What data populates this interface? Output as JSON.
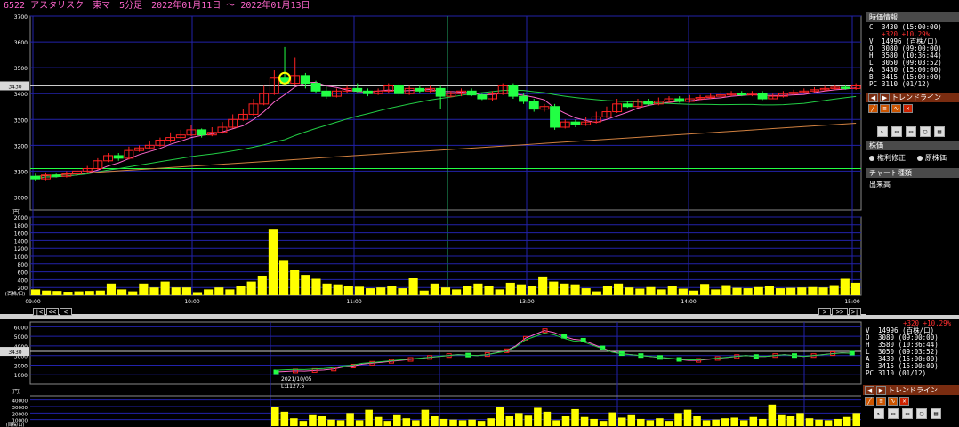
{
  "title": "6522 アスタリスク　東マ　5分足　2022年01月11日 〜 2022年01月13日",
  "colors": {
    "up": "#ff2222",
    "down": "#22ff44",
    "ma_short": "#ff66cc",
    "ma_mid": "#22cc44",
    "ma_long": "#d08040",
    "volume": "#ffff00",
    "grid": "#2222aa",
    "hline": "#22ff44"
  },
  "main_chart": {
    "y_ticks": [
      "3700",
      "3600",
      "3500",
      "3400",
      "3300",
      "3200",
      "3100",
      "3000"
    ],
    "price_marker": "3430",
    "x_ticks": [
      "09:00",
      "10:00",
      "11:00",
      "13:00",
      "14:00",
      "15:00"
    ],
    "candles": [
      [
        3080,
        3070,
        3090,
        3060
      ],
      [
        3070,
        3085,
        3095,
        3065
      ],
      [
        3085,
        3080,
        3090,
        3075
      ],
      [
        3080,
        3090,
        3100,
        3075
      ],
      [
        3090,
        3100,
        3110,
        3085
      ],
      [
        3100,
        3110,
        3120,
        3095
      ],
      [
        3110,
        3140,
        3150,
        3105
      ],
      [
        3140,
        3160,
        3170,
        3135
      ],
      [
        3160,
        3150,
        3170,
        3140
      ],
      [
        3150,
        3180,
        3195,
        3145
      ],
      [
        3180,
        3190,
        3200,
        3175
      ],
      [
        3190,
        3200,
        3215,
        3185
      ],
      [
        3200,
        3220,
        3230,
        3195
      ],
      [
        3220,
        3230,
        3250,
        3210
      ],
      [
        3230,
        3240,
        3260,
        3225
      ],
      [
        3240,
        3260,
        3280,
        3235
      ],
      [
        3260,
        3240,
        3265,
        3230
      ],
      [
        3240,
        3250,
        3270,
        3235
      ],
      [
        3250,
        3270,
        3290,
        3245
      ],
      [
        3270,
        3300,
        3320,
        3265
      ],
      [
        3300,
        3320,
        3340,
        3295
      ],
      [
        3320,
        3360,
        3380,
        3315
      ],
      [
        3360,
        3400,
        3430,
        3355
      ],
      [
        3400,
        3460,
        3490,
        3395
      ],
      [
        3460,
        3440,
        3580,
        3430
      ],
      [
        3440,
        3470,
        3540,
        3435
      ],
      [
        3470,
        3440,
        3480,
        3420
      ],
      [
        3440,
        3410,
        3450,
        3400
      ],
      [
        3410,
        3390,
        3430,
        3380
      ],
      [
        3390,
        3410,
        3420,
        3385
      ],
      [
        3410,
        3420,
        3430,
        3400
      ],
      [
        3420,
        3410,
        3440,
        3405
      ],
      [
        3410,
        3400,
        3420,
        3390
      ],
      [
        3400,
        3410,
        3420,
        3395
      ],
      [
        3410,
        3430,
        3440,
        3400
      ],
      [
        3430,
        3400,
        3440,
        3390
      ],
      [
        3400,
        3420,
        3430,
        3395
      ],
      [
        3420,
        3410,
        3430,
        3400
      ],
      [
        3410,
        3420,
        3430,
        3405
      ],
      [
        3420,
        3390,
        3430,
        3340
      ],
      [
        3390,
        3400,
        3410,
        3385
      ],
      [
        3400,
        3410,
        3420,
        3390
      ],
      [
        3410,
        3395,
        3420,
        3390
      ],
      [
        3395,
        3380,
        3400,
        3375
      ],
      [
        3380,
        3400,
        3410,
        3370
      ],
      [
        3400,
        3430,
        3440,
        3395
      ],
      [
        3430,
        3390,
        3440,
        3380
      ],
      [
        3390,
        3370,
        3400,
        3360
      ],
      [
        3370,
        3340,
        3380,
        3330
      ],
      [
        3340,
        3350,
        3360,
        3330
      ],
      [
        3350,
        3270,
        3360,
        3260
      ],
      [
        3270,
        3290,
        3300,
        3265
      ],
      [
        3290,
        3280,
        3300,
        3270
      ],
      [
        3280,
        3290,
        3310,
        3275
      ],
      [
        3290,
        3310,
        3330,
        3285
      ],
      [
        3310,
        3330,
        3350,
        3305
      ],
      [
        3330,
        3360,
        3380,
        3325
      ],
      [
        3360,
        3350,
        3370,
        3345
      ],
      [
        3350,
        3370,
        3380,
        3345
      ],
      [
        3370,
        3360,
        3380,
        3355
      ],
      [
        3360,
        3370,
        3385,
        3355
      ],
      [
        3370,
        3380,
        3390,
        3365
      ],
      [
        3380,
        3370,
        3390,
        3365
      ],
      [
        3370,
        3380,
        3395,
        3365
      ],
      [
        3380,
        3385,
        3395,
        3375
      ],
      [
        3385,
        3390,
        3400,
        3380
      ],
      [
        3390,
        3395,
        3410,
        3385
      ],
      [
        3395,
        3400,
        3410,
        3390
      ],
      [
        3400,
        3395,
        3410,
        3390
      ],
      [
        3395,
        3400,
        3410,
        3390
      ],
      [
        3400,
        3380,
        3410,
        3375
      ],
      [
        3380,
        3390,
        3400,
        3380
      ],
      [
        3390,
        3400,
        3410,
        3385
      ],
      [
        3400,
        3405,
        3415,
        3395
      ],
      [
        3405,
        3410,
        3420,
        3400
      ],
      [
        3410,
        3415,
        3425,
        3405
      ],
      [
        3415,
        3420,
        3430,
        3410
      ],
      [
        3420,
        3425,
        3435,
        3415
      ],
      [
        3425,
        3420,
        3435,
        3415
      ],
      [
        3420,
        3430,
        3440,
        3415
      ]
    ],
    "volume_ticks": [
      "2000",
      "1800",
      "1600",
      "1400",
      "1200",
      "1000",
      "800",
      "600",
      "400",
      "200"
    ],
    "volume_unit": "(百株/口)",
    "volumes": [
      150,
      120,
      110,
      90,
      100,
      110,
      120,
      300,
      150,
      100,
      300,
      200,
      350,
      200,
      200,
      80,
      150,
      200,
      150,
      250,
      350,
      500,
      1700,
      900,
      650,
      520,
      420,
      300,
      280,
      250,
      220,
      180,
      200,
      250,
      180,
      450,
      120,
      300,
      200,
      150,
      250,
      300,
      250,
      150,
      320,
      280,
      250,
      480,
      350,
      300,
      280,
      180,
      100,
      250,
      300,
      200,
      170,
      210,
      150,
      250,
      170,
      120,
      290,
      150,
      260,
      190,
      180,
      210,
      230,
      180,
      190,
      200,
      210,
      200,
      260,
      420,
      320
    ]
  },
  "unit_label": "(円)",
  "volume_unit_short": "(百株/口)",
  "nav_buttons": [
    "|<",
    "<<",
    "<",
    ">",
    ">>",
    ">|"
  ],
  "info_panel": {
    "header": "時価情報",
    "rows": [
      {
        "key": "C",
        "value": "3430 (15:00:00)"
      },
      {
        "key": "",
        "value": "+320 +10.29%"
      },
      {
        "key": "V",
        "value": "14996 (百株/口)"
      },
      {
        "key": "O",
        "value": "3080 (09:00:00)"
      },
      {
        "key": "H",
        "value": "3580 (10:36:44)"
      },
      {
        "key": "L",
        "value": "3050 (09:03:52)"
      },
      {
        "key": "A",
        "value": "3430 (15:00:00)"
      },
      {
        "key": "B",
        "value": "3415 (15:00:00)"
      },
      {
        "key": "PC",
        "value": "3110 (01/12)"
      }
    ]
  },
  "trendline": {
    "label": "トレンドライン"
  },
  "stock_price": {
    "header": "株価",
    "options": [
      "権利修正",
      "原株価"
    ]
  },
  "chart_type": {
    "header": "チャート種類",
    "value": "出来高"
  },
  "bottom_info": {
    "change": "+320 +10.29%",
    "rows": [
      {
        "key": "V",
        "value": "14996 (百株/口)"
      },
      {
        "key": "O",
        "value": "3080 (09:00:00)"
      },
      {
        "key": "H",
        "value": "3580 (10:36:44)"
      },
      {
        "key": "L",
        "value": "3050 (09:03:52)"
      },
      {
        "key": "A",
        "value": "3430 (15:00:00)"
      },
      {
        "key": "B",
        "value": "3415 (15:00:00)"
      },
      {
        "key": "PC",
        "value": "3110 (01/12)"
      }
    ]
  },
  "bottom_chart": {
    "y_ticks": [
      "6000",
      "5000",
      "4000",
      "3000",
      "2000",
      "1000"
    ],
    "price_marker": "3430",
    "annotation": [
      "2021/10/05",
      "L:1127.5"
    ],
    "vol_ticks": [
      "40000",
      "30000",
      "20000",
      "10000"
    ],
    "line": [
      1300,
      1350,
      1400,
      1380,
      1450,
      1500,
      1600,
      1800,
      1900,
      2100,
      2200,
      2300,
      2400,
      2500,
      2600,
      2700,
      2800,
      2900,
      3000,
      3100,
      3050,
      3000,
      3100,
      3300,
      3500,
      4000,
      4800,
      5200,
      5600,
      5400,
      5000,
      4700,
      4600,
      4200,
      3800,
      3400,
      3200,
      3100,
      3000,
      2900,
      2800,
      2700,
      2600,
      2500,
      2500,
      2600,
      2700,
      2800,
      2900,
      3000,
      2900,
      2900,
      3000,
      3100,
      3000,
      2900,
      3000,
      3100,
      3200,
      3300,
      3250
    ],
    "volumes": [
      30000,
      22000,
      12000,
      8000,
      18000,
      15000,
      10000,
      9000,
      20000,
      9000,
      25000,
      14000,
      8000,
      18000,
      12000,
      9000,
      25000,
      15000,
      11000,
      10000,
      9000,
      10000,
      8000,
      12000,
      29000,
      15000,
      20000,
      16000,
      28000,
      22000,
      9000,
      15000,
      26000,
      14000,
      11000,
      8000,
      21000,
      13000,
      18000,
      11000,
      9000,
      12000,
      8000,
      20000,
      25000,
      15000,
      9000,
      10000,
      12000,
      13000,
      9000,
      14000,
      11000,
      33000,
      18000,
      15000,
      20000,
      12000,
      10000,
      9000,
      11000,
      14000,
      20000
    ]
  }
}
